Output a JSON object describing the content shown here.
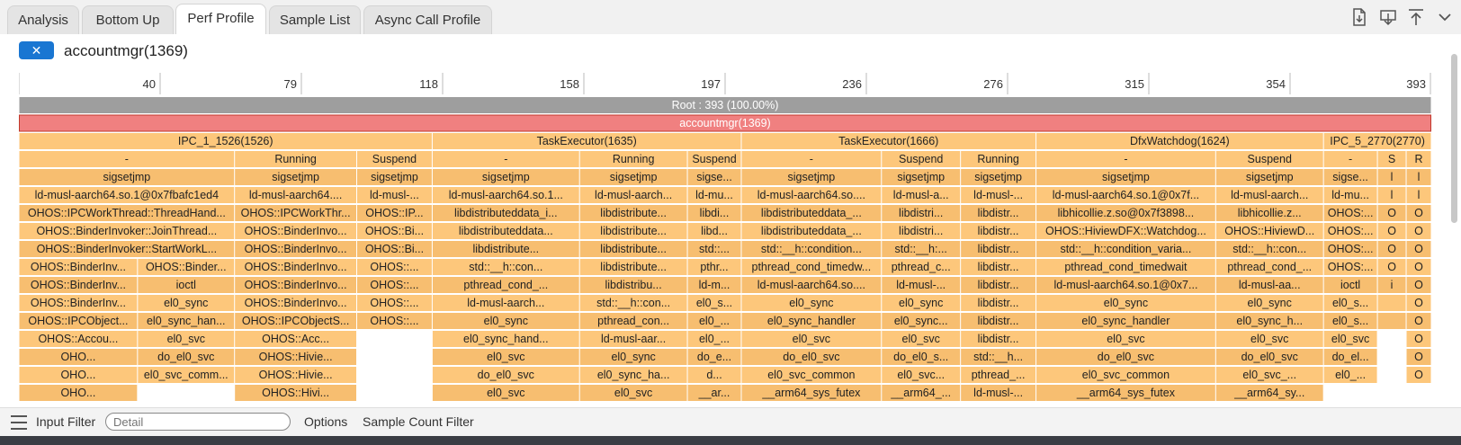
{
  "tabs": [
    {
      "label": "Analysis",
      "active": false
    },
    {
      "label": "Bottom Up",
      "active": false
    },
    {
      "label": "Perf Profile",
      "active": true
    },
    {
      "label": "Sample List",
      "active": false
    },
    {
      "label": "Async Call Profile",
      "active": false
    }
  ],
  "toolbar": {
    "icons": [
      "file-export-icon",
      "download-icon",
      "upload-icon",
      "chevron-down-icon"
    ]
  },
  "selection": {
    "close_label": "✕",
    "process_title": "accountmgr(1369)"
  },
  "axis": {
    "max": 393,
    "ticks": [
      "40",
      "79",
      "118",
      "158",
      "197",
      "236",
      "276",
      "315",
      "354",
      "393"
    ]
  },
  "colors": {
    "root": "#9e9e9e",
    "process": "#f08080",
    "frame": "#fdc77b",
    "frame_dark": "#f7be70",
    "tab_active": "#ffffff",
    "accent": "#1976d2"
  },
  "flame": {
    "root": "Root : 393 (100.00%)",
    "process": "accountmgr(1369)",
    "threads": [
      {
        "name": "IPC_1_1526(1526)",
        "span": [
          0,
          115
        ],
        "columns": [
          {
            "span": [
              0,
              60
            ],
            "frames": [
              "-",
              "sigsetjmp",
              "ld-musl-aarch64.so.1@0x7fbafc1ed4",
              "OHOS::IPCWorkThread::ThreadHandler(v...",
              "OHOS::BinderInvoker::JoinThread(bool)",
              "OHOS::BinderInvoker::StartWorkLoop()"
            ],
            "children": [
              {
                "span": [
                  0,
                  33
                ],
                "frames": [
                  "OHOS::BinderInv...",
                  "OHOS::BinderInvoke...",
                  "OHOS::BinderInvoke...",
                  "OHOS::IPCObject...",
                  "OHOS::Accou...",
                  "OHO...",
                  "OHO...",
                  "OHO..."
                ]
              },
              {
                "span": [
                  33,
                  60
                ],
                "frames": [
                  "OHOS::BinderCo...",
                  "ioctl",
                  "el0_sync",
                  "el0_sync_handl...",
                  "el0_svc",
                  "do_el0_svc",
                  "el0_svc_comm..."
                ]
              }
            ]
          },
          {
            "span": [
              60,
              94
            ],
            "frames": [
              "Running",
              "sigsetjmp",
              "ld-musl-aarch64.so...",
              "OHOS::IPCWorkThread...",
              "OHOS::BinderInvoker...",
              "OHOS::BinderInvoker...",
              "OHOS::BinderInvoker...",
              "OHOS::BinderInvoker...",
              "OHOS::BinderInvoker...",
              "OHOS::IPCObjectStub...",
              "OHOS::Acc...",
              "OHOS::Hivie...",
              "OHOS::Hivie...",
              "OHOS::Hivi..."
            ]
          },
          {
            "span": [
              94,
              115
            ],
            "frames": [
              "Suspend",
              "sigsetjmp",
              "ld-musl-aar...",
              "OHOS::IPCWo...",
              "OHOS::Binde...",
              "OHOS::Binde...",
              "OHOS::...",
              "OHOS::...",
              "OHOS::...",
              "OHOS::..."
            ]
          }
        ]
      },
      {
        "name": "TaskExecutor(1635)",
        "span": [
          115,
          201
        ],
        "columns": [
          {
            "span": [
              115,
              156
            ],
            "frames": [
              "-",
              "sigsetjmp",
              "ld-musl-aarch64.so.1@0x7...",
              "libdistributeddata_inner...",
              "libdistributeddata...",
              "libdistribute...",
              "std::__h::con...",
              "pthread_cond_...",
              "ld-musl-aarch...",
              "el0_sync",
              "el0_sync_hand...",
              "el0_svc",
              "do_el0_svc",
              "el0_svc"
            ]
          },
          {
            "span": [
              156,
              186
            ],
            "frames": [
              "Running",
              "sigsetjmp",
              "ld-musl-aarch...",
              "libdistribute...",
              "libdistribute...",
              "libdistribute...",
              "libdistribute...",
              "libdistribu...",
              "std::__h::cond...",
              "pthread_con...",
              "ld-musl-aar...",
              "el0_sync",
              "el0_sync_ha...",
              "el0_svc"
            ]
          },
          {
            "span": [
              186,
              201
            ],
            "frames": [
              "Suspend",
              "sigsetjmp",
              "ld-musl-aa...",
              "libdistrib...",
              "libd...",
              "std::...",
              "pthr...",
              "ld-m...",
              "el0_s...",
              "el0_...",
              "el0_...",
              "do_e...",
              "d...",
              "__ar..."
            ]
          }
        ]
      },
      {
        "name": "TaskExecutor(1666)",
        "span": [
          201,
          283
        ],
        "columns": [
          {
            "span": [
              201,
              240
            ],
            "frames": [
              "-",
              "sigsetjmp",
              "ld-musl-aarch64.so.1@0x...",
              "libdistributeddata_inne...",
              "libdistributeddata_in...",
              "std::__h::condition_v...",
              "pthread_cond_timedwai...",
              "ld-musl-aarch64.so.1@...",
              "el0_sync",
              "el0_sync_handler",
              "el0_svc",
              "do_el0_svc",
              "el0_svc_common",
              "__arm64_sys_futex"
            ]
          },
          {
            "span": [
              240,
              262
            ],
            "frames": [
              "Suspend",
              "sigsetjmp",
              "ld-musl-aar...",
              "libdistribu...",
              "libdistrib...",
              "std::__h::...",
              "pthread_co...",
              "ld-musl-...",
              "el0_sync",
              "el0_sync...",
              "el0_svc",
              "do_el0_s...",
              "el0_svc...",
              "__arm64_..."
            ]
          },
          {
            "span": [
              262,
              283
            ],
            "frames": [
              "Running",
              "sigsetjmp",
              "ld-musl-aar...",
              "libdistribu...",
              "libdistribu...",
              "libdistribu...",
              "libdistribu...",
              "libdistribu...",
              "libdistribu...",
              "libdistribu...",
              "libdistribu...",
              "std::__h::con...",
              "pthread_con...",
              "ld-musl-aar..."
            ]
          }
        ]
      },
      {
        "name": "DfxWatchdog(1624)",
        "span": [
          283,
          363
        ],
        "columns": [
          {
            "span": [
              283,
              333
            ],
            "frames": [
              "-",
              "sigsetjmp",
              "ld-musl-aarch64.so.1@0x7fbafc1...",
              "libhicollie.z.so@0x7f3898eae4",
              "OHOS::HiviewDFX::WatchdogInner...",
              "std::__h::condition_variable::...",
              "pthread_cond_timedwait",
              "ld-musl-aarch64.so.1@0x7...",
              "el0_sync",
              "el0_sync_handler",
              "el0_svc",
              "do_el0_svc",
              "el0_svc_common",
              "__arm64_sys_futex"
            ]
          },
          {
            "span": [
              333,
              363
            ],
            "frames": [
              "Suspend",
              "sigsetjmp",
              "ld-musl-aarch64...",
              "libhicollie.z.s...",
              "OHOS::HiviewDFX...",
              "std::__h::condi...",
              "pthread_cond_ti...",
              "ld-musl-aa...",
              "el0_sync",
              "el0_sync_h...",
              "el0_svc",
              "do_el0_svc",
              "el0_svc_...",
              "__arm64_sy..."
            ]
          }
        ]
      },
      {
        "name": "IPC_5_2770(2770)",
        "span": [
          363,
          393
        ],
        "columns": [
          {
            "span": [
              363,
              378
            ],
            "frames": [
              "-",
              "sigsetj...",
              "ld-musl...",
              "OHOS::I...",
              "OHOS::B...",
              "OHOS::B...",
              "OHOS::...",
              "ioctl",
              "el0_s...",
              "el0_s...",
              "el0_svc",
              "do_el...",
              "el0_..."
            ]
          },
          {
            "span": [
              378,
              386
            ],
            "frames": [
              "S...",
              "l...",
              "l...",
              "O...",
              "O...",
              "O...",
              "O...",
              "i",
              "",
              ""
            ]
          },
          {
            "span": [
              386,
              393
            ],
            "frames": [
              "R...",
              "l...",
              "l...",
              "O...",
              "O...",
              "O...",
              "O...",
              "O...",
              "O...",
              "O...",
              "O",
              "O",
              "O"
            ]
          }
        ]
      }
    ]
  },
  "bottom": {
    "input_filter_label": "Input Filter",
    "detail_placeholder": "Detail",
    "options_label": "Options",
    "sample_count_label": "Sample Count Filter"
  }
}
